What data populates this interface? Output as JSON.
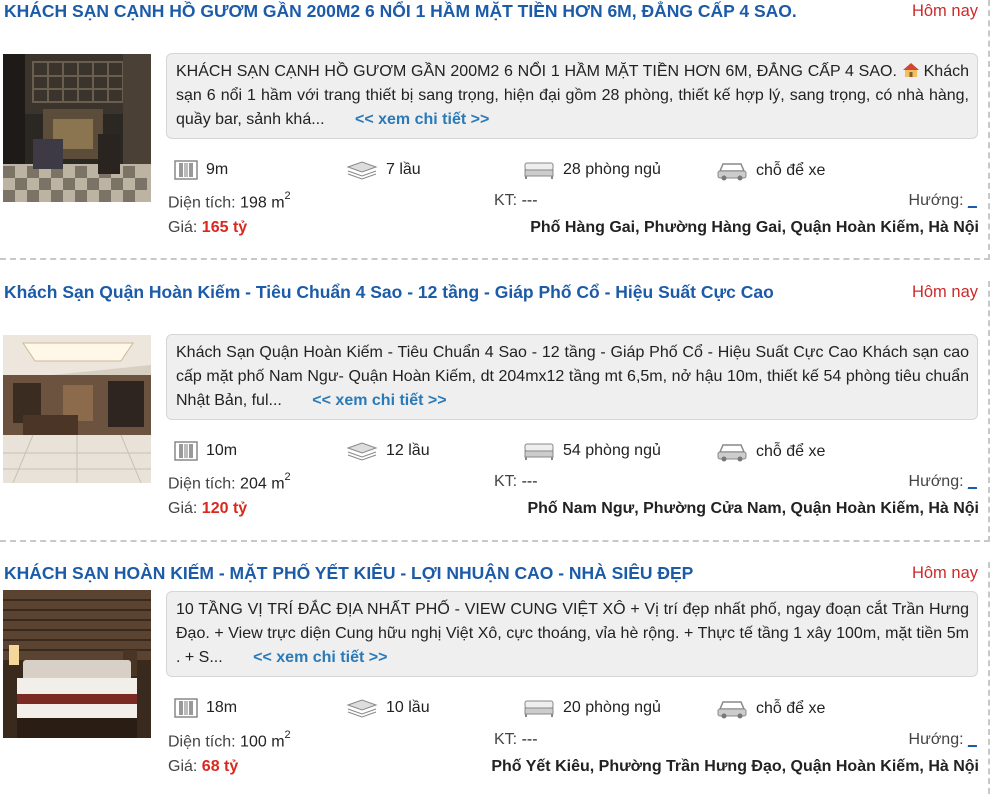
{
  "listings": [
    {
      "title": "KHÁCH SẠN CẠNH HỒ GƯƠM GẦN 200M2 6 NỔI 1 HẦM MẶT TIỀN HƠN 6M, ĐẲNG CẤP 4 SAO.",
      "date": "Hôm nay",
      "description": "KHÁCH SẠN CẠNH HỒ GƯƠM GẦN 200M2 6 NỔI 1 HẦM MẶT TIỀN HƠN 6M, ĐẲNG CẤP 4 SAO. Khách sạn 6 nổi 1 hầm với trang thiết bị sang trọng, hiện đại gồm 28 phòng, thiết kế hợp lý, sang trọng, có nhà hàng, quầy bar, sảnh khá...",
      "more": "<< xem chi tiết >>",
      "frontage": "9m",
      "floors": "7 lầu",
      "bedrooms": "28 phòng ngủ",
      "parking": "chỗ để xe",
      "area_label": "Diện tích:",
      "area": "198 m",
      "area_sup": "2",
      "kt_label": "KT:",
      "kt": "---",
      "huong_label": "Hướng:",
      "huong": "_",
      "price_label": "Giá:",
      "price": "165 tỷ",
      "address": "Phố Hàng Gai, Phường Hàng Gai, Quận Hoàn Kiếm, Hà Nội"
    },
    {
      "title": "Khách Sạn Quận Hoàn Kiếm - Tiêu Chuẩn 4 Sao - 12 tầng - Giáp Phố Cổ - Hiệu Suất Cực Cao",
      "date": "Hôm nay",
      "description": "Khách Sạn Quận Hoàn Kiếm - Tiêu Chuẩn 4 Sao - 12 tầng - Giáp Phố Cổ - Hiệu Suất Cực Cao Khách sạn cao cấp mặt phố Nam Ngư- Quận Hoàn Kiếm, dt 204mx12 tầng mt 6,5m, nở hậu 10m, thiết kế 54 phòng tiêu chuẩn Nhật Bản, ful...",
      "more": "<< xem chi tiết >>",
      "frontage": "10m",
      "floors": "12 lầu",
      "bedrooms": "54 phòng ngủ",
      "parking": "chỗ để xe",
      "area_label": "Diện tích:",
      "area": "204 m",
      "area_sup": "2",
      "kt_label": "KT:",
      "kt": "---",
      "huong_label": "Hướng:",
      "huong": "_",
      "price_label": "Giá:",
      "price": "120 tỷ",
      "address": "Phố Nam Ngư, Phường Cửa Nam, Quận Hoàn Kiếm, Hà Nội"
    },
    {
      "title": "KHÁCH SẠN HOÀN KIẾM - MẶT PHỐ YẾT KIÊU - LỢI NHUẬN CAO - NHÀ SIÊU ĐẸP",
      "date": "Hôm nay",
      "description": "10 TẦNG VỊ TRÍ ĐẮC ĐỊA NHẤT PHỐ - VIEW CUNG VIỆT XÔ + Vị trí đẹp nhất phố, ngay đoạn cắt Trần Hưng Đạo. + View trực diện Cung hữu nghị Việt Xô, cực thoáng, vỉa hè rộng. + Thực tế tầng 1 xây 100m, mặt tiền 5m . + S...",
      "more": "<< xem chi tiết >>",
      "frontage": "18m",
      "floors": "10 lầu",
      "bedrooms": "20 phòng ngủ",
      "parking": "chỗ để xe",
      "area_label": "Diện tích:",
      "area": "100 m",
      "area_sup": "2",
      "kt_label": "KT:",
      "kt": "---",
      "huong_label": "Hướng:",
      "huong": "_",
      "price_label": "Giá:",
      "price": "68 tỷ",
      "address": "Phố Yết Kiêu, Phường Trần Hưng Đạo, Quận Hoàn Kiếm, Hà Nội"
    }
  ],
  "colors": {
    "title": "#1c5ba8",
    "date": "#cc2a2a",
    "price": "#d9281e",
    "more_link": "#2a7ab8"
  },
  "icons": [
    "frontage-icon",
    "floors-icon",
    "bedroom-icon",
    "car-icon",
    "house-icon"
  ]
}
